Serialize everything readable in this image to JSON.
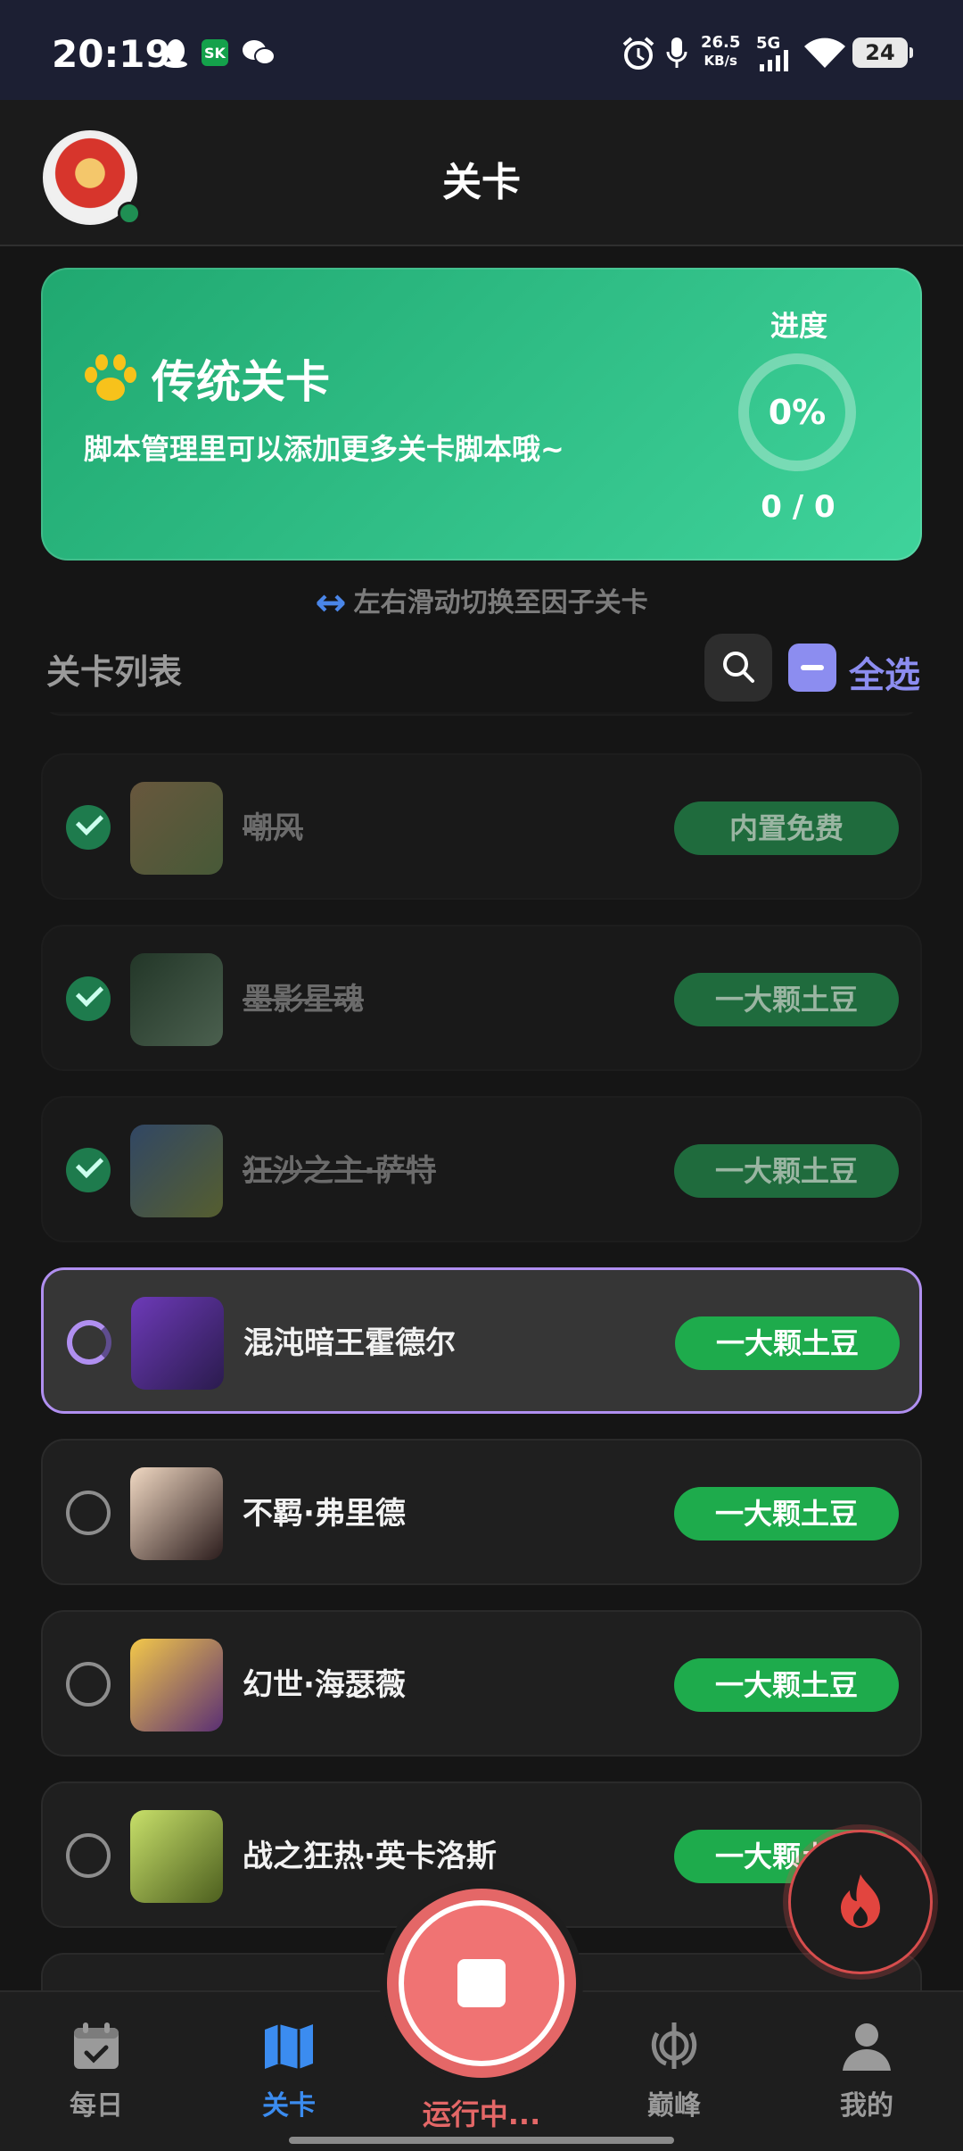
{
  "status_bar": {
    "time": "20:19",
    "sk_label": "SK",
    "net_speed": "26.5",
    "net_unit": "KB/s",
    "network": "5G",
    "battery": "24"
  },
  "header": {
    "title": "关卡"
  },
  "banner": {
    "title": "传统关卡",
    "subtitle": "脚本管理里可以添加更多关卡脚本哦~",
    "progress_label": "进度",
    "progress_percent": "0%",
    "progress_count": "0 / 0"
  },
  "swipe_hint": "左右滑动切换至因子关卡",
  "list": {
    "title": "关卡列表",
    "select_all": "全选",
    "items": [
      {
        "name": "嘲风",
        "badge": "内置免费",
        "state": "done"
      },
      {
        "name": "墨影星魂",
        "badge": "一大颗土豆",
        "state": "done"
      },
      {
        "name": "狂沙之主·萨特",
        "badge": "一大颗土豆",
        "state": "done"
      },
      {
        "name": "混沌暗王霍德尔",
        "badge": "一大颗土豆",
        "state": "running"
      },
      {
        "name": "不羁·弗里德",
        "badge": "一大颗土豆",
        "state": "pending"
      },
      {
        "name": "幻世·海瑟薇",
        "badge": "一大颗土豆",
        "state": "pending"
      },
      {
        "name": "战之狂热·英卡洛斯",
        "badge": "一大颗土豆",
        "state": "pending"
      }
    ]
  },
  "bottom_nav": {
    "items": [
      {
        "label": "每日",
        "icon": "calendar-check-icon"
      },
      {
        "label": "关卡",
        "icon": "map-icon"
      },
      {
        "label": "巅峰",
        "icon": "emblem-icon"
      },
      {
        "label": "我的",
        "icon": "person-icon"
      }
    ],
    "running_label": "运行中..."
  },
  "colors": {
    "accent_blue": "#3b8cf0",
    "accent_purple": "#b08ff0",
    "banner_green": "#2ebd82",
    "badge_green": "#1eab4c",
    "stop_red": "#e46767"
  }
}
